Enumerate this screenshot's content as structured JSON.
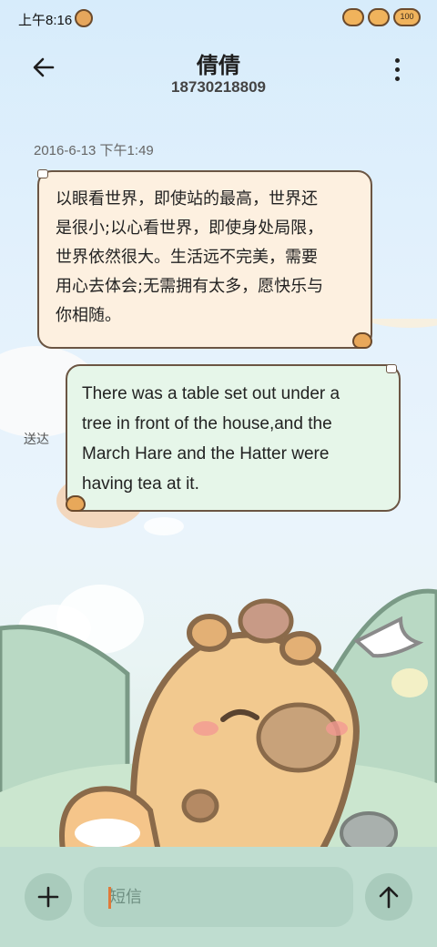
{
  "status_bar": {
    "time": "上午8:16",
    "battery_level": "100",
    "icons": [
      "signal-icon",
      "wifi-icon",
      "battery-icon"
    ]
  },
  "header": {
    "contact_name": "倩倩",
    "phone_number": "18730218809",
    "back_icon": "back-arrow-icon",
    "more_icon": "more-vertical-icon"
  },
  "conversation": {
    "timestamp": "2016-6-13 下午1:49",
    "messages": [
      {
        "direction": "incoming",
        "lines": [
          "以眼看世界，即使站的最高，世界还",
          "是很小;以心看世界，即使身处局限，",
          "世界依然很大。生活远不完美，需要",
          "用心去体会;无需拥有太多，愿快乐与",
          "你相随。"
        ]
      },
      {
        "direction": "outgoing",
        "lines": [
          "There was a table set out under a",
          "tree in front of the house,and the",
          "March Hare and the Hatter were",
          "having tea at it."
        ],
        "status": "送达"
      }
    ]
  },
  "composer": {
    "placeholder": "短信",
    "add_icon": "plus-icon",
    "send_icon": "send-arrow-up-icon"
  },
  "colors": {
    "incoming_bubble": "#fdf0e0",
    "outgoing_bubble": "#e6f6e9",
    "bubble_border": "#6b5543",
    "composer_bg": "#bfddd0",
    "capybara": "#f2c98f"
  }
}
